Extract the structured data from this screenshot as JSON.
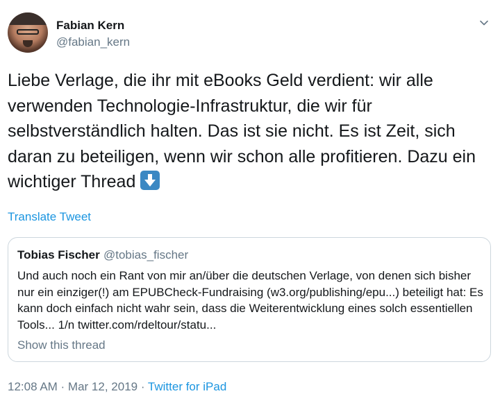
{
  "author": {
    "name": "Fabian Kern",
    "handle": "@fabian_kern"
  },
  "tweet": {
    "text": "Liebe Verlage, die ihr mit eBooks Geld verdient: wir alle verwenden Technologie-Infrastruktur, die wir für selbstverständlich halten. Das ist sie nicht. Es ist Zeit, sich daran zu beteiligen, wenn wir schon alle profitieren. Dazu ein wichtiger Thread",
    "emoji": "down-arrow-button-emoji"
  },
  "translate_label": "Translate Tweet",
  "quoted": {
    "name": "Tobias Fischer",
    "handle": "@tobias_fischer",
    "text": "Und auch noch ein Rant von mir an/über die deutschen Verlage, von denen sich bisher nur ein einziger(!) am EPUBCheck-Fundraising (w3.org/publishing/epu...) beteiligt hat: Es kann doch einfach nicht wahr sein, dass die Weiterentwicklung eines solch essentiellen Tools... 1/n twitter.com/rdeltour/statu...",
    "show_thread": "Show this thread"
  },
  "meta": {
    "timestamp": "12:08 AM · Mar 12, 2019 · ",
    "source": "Twitter for iPad"
  },
  "icons": {
    "menu": "chevron-down-icon"
  },
  "colors": {
    "link": "#1b95e0",
    "secondary_text": "#657786",
    "primary_text": "#14171a",
    "border": "#ccd6dd"
  }
}
